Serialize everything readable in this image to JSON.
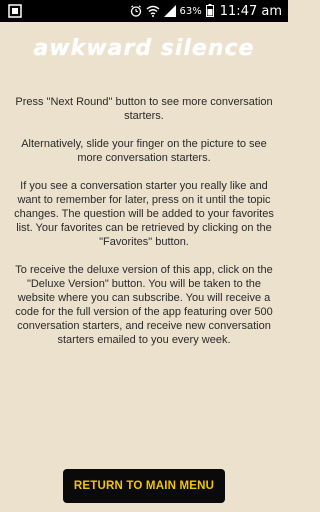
{
  "status_bar": {
    "battery_percent": "63%",
    "time": "11:47 am"
  },
  "header": {
    "title": "awkward silence"
  },
  "instructions": {
    "paragraphs": [
      "Press \"Next Round\" button to see more conversation starters.",
      "Alternatively, slide your finger on the picture to see more conversation starters.",
      "If you see a conversation starter you really like and want to remember for later, press on it until the topic changes. The question will be added to your favorites list. Your favorites can be retrieved by clicking on the \"Favorites\" button.",
      "To receive the deluxe version of this app, click on the \"Deluxe Version\" button. You will be taken to the website where you can subscribe. You will receive a code for the full version of the app featuring over 500 conversation starters, and receive new conversation starters emailed to you every week."
    ]
  },
  "footer": {
    "main_menu_label": "RETURN TO MAIN MENU"
  },
  "colors": {
    "background": "#ebe1cd",
    "button_bg": "#0a0a0a",
    "button_text": "#f5c400"
  }
}
